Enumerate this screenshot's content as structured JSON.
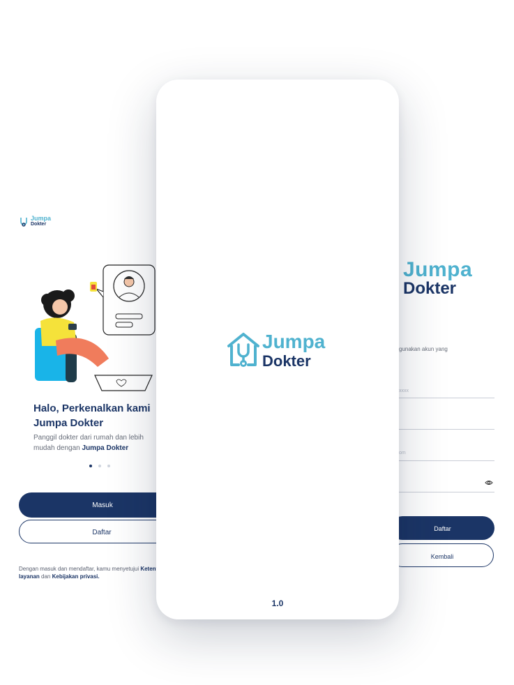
{
  "onboarding": {
    "logo_line1": "Jumpa",
    "logo_line2": "Dokter",
    "title": "Halo, Perkenalkan kami Jumpa Dokter",
    "desc_prefix": "Panggil dokter dari rumah dan lebih mudah dengan ",
    "desc_bold": "Jumpa Dokter",
    "page_indicator": {
      "current": 1,
      "total": 3
    },
    "masuk_label": "Masuk",
    "daftar_label": "Daftar",
    "terms_prefix": "Dengan masuk dan mendaftar, kamu menyetujui ",
    "terms_link1": "Ketentuan layanan",
    "terms_mid": " dan ",
    "terms_link2": "Kebijakan privasi."
  },
  "splash": {
    "logo_line1": "Jumpa",
    "logo_line2": "Dokter",
    "version": "1.0"
  },
  "register": {
    "logo_line1": "Jumpa",
    "logo_line2": "Dokter",
    "subtitle_partial": "gunakan akun yang",
    "field1_placeholder_partial": "xxxx",
    "field3_placeholder_partial": "om",
    "daftar_label": "Daftar",
    "kembali_label": "Kembali"
  },
  "colors": {
    "navy": "#1b3566",
    "teal": "#4fb2cf",
    "coral": "#f07c5c",
    "yellow": "#f5e23a",
    "cyan": "#19b4e8"
  }
}
